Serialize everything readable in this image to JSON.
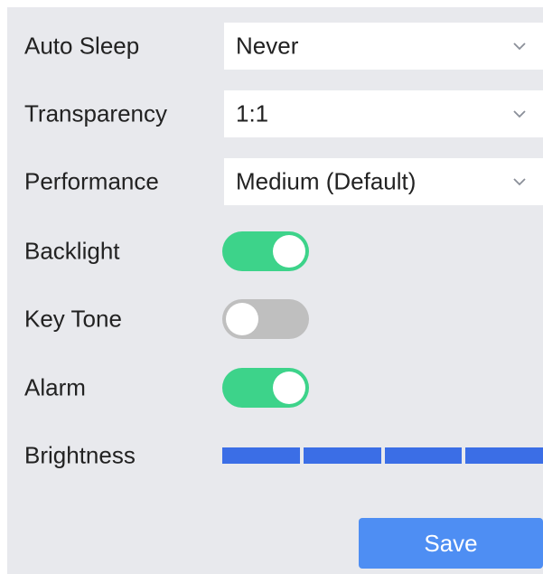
{
  "settings": {
    "auto_sleep": {
      "label": "Auto Sleep",
      "value": "Never"
    },
    "transparency": {
      "label": "Transparency",
      "value": "1:1"
    },
    "performance": {
      "label": "Performance",
      "value": "Medium (Default)"
    },
    "backlight": {
      "label": "Backlight",
      "state": "on"
    },
    "key_tone": {
      "label": "Key Tone",
      "state": "off"
    },
    "alarm": {
      "label": "Alarm",
      "state": "on"
    },
    "brightness": {
      "label": "Brightness",
      "level": 4,
      "max": 4
    }
  },
  "save_label": "Save",
  "icons": {
    "dropdown": "chevron-down-icon"
  },
  "colors": {
    "toggle_on": "#3dd38a",
    "toggle_off": "#bfbfbf",
    "brightness_bar": "#3b6ee6",
    "save_button": "#4e8ef3",
    "panel_background": "#e8e9ed"
  }
}
